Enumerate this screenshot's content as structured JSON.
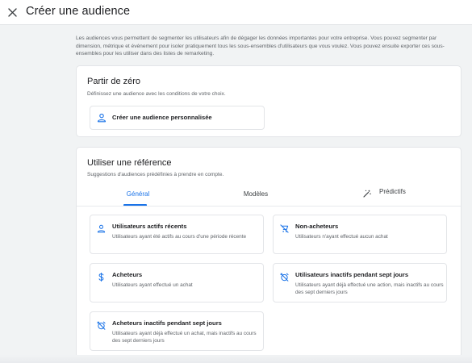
{
  "header": {
    "title": "Créer une audience",
    "close_icon": "close-icon"
  },
  "intro": "Les audiences vous permettent de segmenter les utilisateurs afin de dégager les données importantes pour votre entreprise. Vous pouvez segmenter par dimension, métrique et événement pour isoler pratiquement tous les sous-ensembles d'utilisateurs que vous voulez. Vous pouvez ensuite exporter ces sous-ensembles pour les utiliser dans des listes de remarketing.",
  "from_scratch": {
    "heading": "Partir de zéro",
    "subheading": "Définissez une audience avec les conditions de votre choix.",
    "custom_button": {
      "label": "Créer une audience personnalisée",
      "icon": "person-icon"
    }
  },
  "reference": {
    "heading": "Utiliser une référence",
    "subheading": "Suggestions d'audiences prédéfinies à prendre en compte.",
    "tabs": [
      {
        "label": "Général",
        "active": true
      },
      {
        "label": "Modèles",
        "active": false
      },
      {
        "label": "Prédictifs",
        "active": false,
        "icon": "magic-wand-icon"
      }
    ],
    "suggestions": [
      {
        "title": "Utilisateurs actifs récents",
        "description": "Utilisateurs ayant été actifs au cours d'une période récente",
        "icon": "person-icon"
      },
      {
        "title": "Non-acheteurs",
        "description": "Utilisateurs n'ayant effectué aucun achat",
        "icon": "no-purchase-icon"
      },
      {
        "title": "Acheteurs",
        "description": "Utilisateurs ayant effectué un achat",
        "icon": "dollar-icon"
      },
      {
        "title": "Utilisateurs inactifs pendant sept jours",
        "description": "Utilisateurs ayant déjà effectué une action, mais inactifs au cours des sept derniers jours",
        "icon": "alarm-off-icon"
      },
      {
        "title": "Acheteurs inactifs pendant sept jours",
        "description": "Utilisateurs ayant déjà effectué un achat, mais inactifs au cours des sept derniers jours",
        "icon": "alarm-off-icon"
      }
    ]
  },
  "colors": {
    "accent": "#1a73e8",
    "background": "#f1f3f4",
    "card_border": "#e3e5e8",
    "secondary_text": "#5f6368"
  }
}
